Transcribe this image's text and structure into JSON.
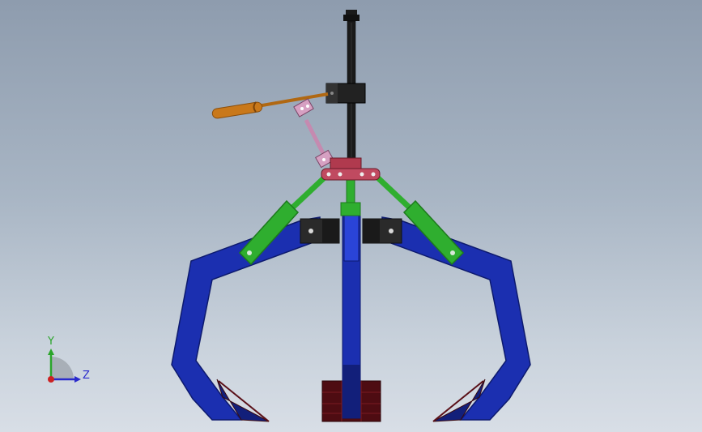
{
  "viewport": {
    "background_top": "#8e9cae",
    "background_bottom": "#d8dee6"
  },
  "model": {
    "colors": {
      "jaw": "#1b2fb0",
      "jaw_dark": "#121f7a",
      "link_green": "#2fae2f",
      "link_green_dark": "#1d7a1d",
      "hub_red": "#b03a4e",
      "handle_orange": "#c9781a",
      "connector_pink": "#c58ab0",
      "column_black": "#1a1a1a",
      "block_black": "#2a2a2a",
      "base_red": "#5a0f14"
    }
  },
  "triad": {
    "y_label": "Y",
    "z_label": "Z",
    "y_color": "#2aa52a",
    "z_color": "#2a2acc",
    "origin_color": "#cc2222"
  }
}
